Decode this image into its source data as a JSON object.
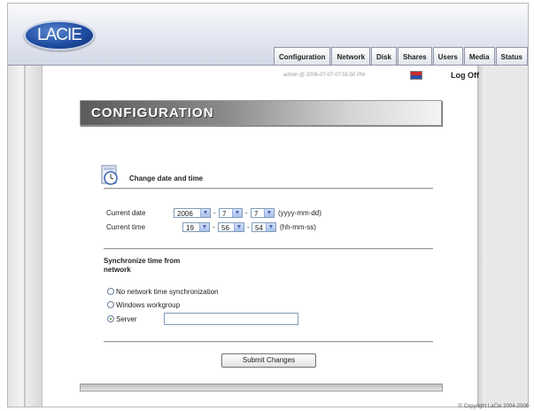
{
  "brand": {
    "logo_text": "LACIE"
  },
  "tabs": [
    {
      "label": "Configuration"
    },
    {
      "label": "Network"
    },
    {
      "label": "Disk"
    },
    {
      "label": "Shares"
    },
    {
      "label": "Users"
    },
    {
      "label": "Media"
    },
    {
      "label": "Status"
    }
  ],
  "session": {
    "user_info": "admin @ 2006-07-07 07:55:50 PM",
    "logoff_label": "Log Off"
  },
  "page": {
    "title": "CONFIGURATION"
  },
  "date_time": {
    "section_title": "Change date and time",
    "current_date_label": "Current date",
    "year": "2006",
    "month": "7",
    "day": "7",
    "date_format": "(yyyy-mm-dd)",
    "current_time_label": "Current time",
    "hour": "19",
    "minute": "56",
    "second": "54",
    "time_format": "(hh-mm-ss)",
    "separator": "-"
  },
  "sync": {
    "title": "Synchronize time from network",
    "options": [
      {
        "label": "No network time synchronization",
        "selected": false
      },
      {
        "label": "Windows workgroup",
        "selected": false
      },
      {
        "label": "Server",
        "selected": true
      }
    ],
    "server_value": ""
  },
  "actions": {
    "submit_label": "Submit Changes"
  },
  "footer": {
    "copyright": "© Copyright LaCie 2004-2006"
  },
  "colors": {
    "link_blue": "#1f4ca1",
    "radio_on": "#2d9b2d"
  }
}
